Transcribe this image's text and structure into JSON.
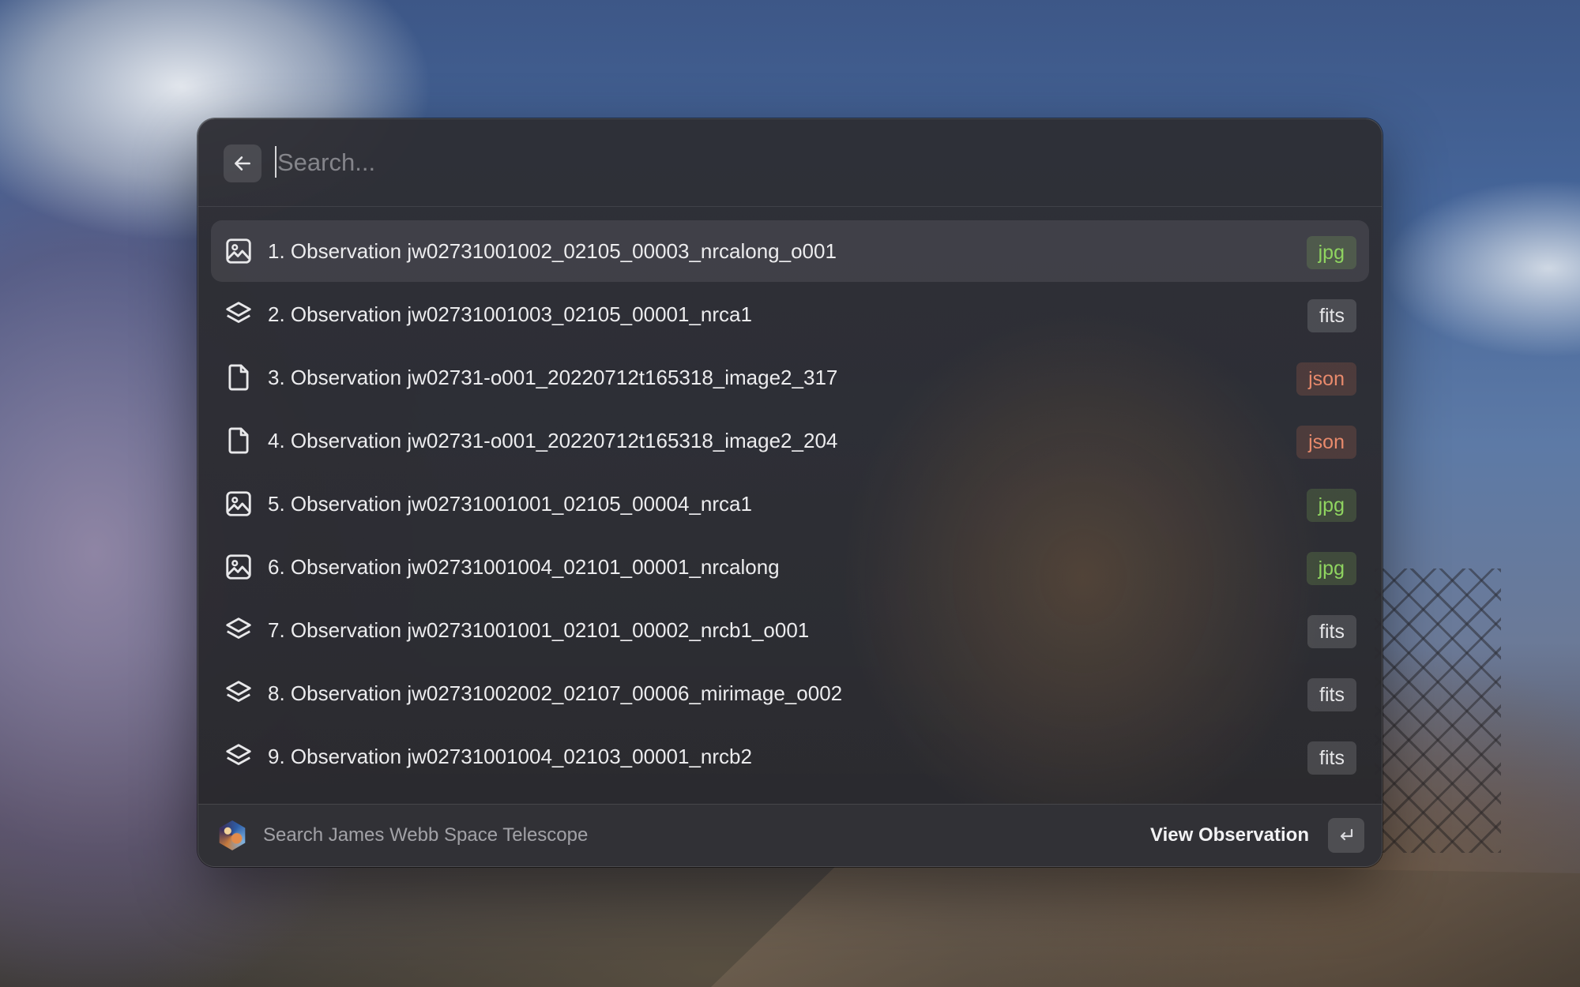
{
  "search": {
    "placeholder": "Search...",
    "value": "",
    "back_icon": "arrow-left-icon"
  },
  "results": [
    {
      "index": "1.",
      "title": "1. Observation jw02731001002_02105_00003_nrcalong_o001",
      "icon": "image-icon",
      "badge": "jpg",
      "selected": true
    },
    {
      "index": "2.",
      "title": "2. Observation jw02731001003_02105_00001_nrca1",
      "icon": "layers-icon",
      "badge": "fits"
    },
    {
      "index": "3.",
      "title": "3. Observation jw02731-o001_20220712t165318_image2_317",
      "icon": "document-icon",
      "badge": "json"
    },
    {
      "index": "4.",
      "title": "4. Observation jw02731-o001_20220712t165318_image2_204",
      "icon": "document-icon",
      "badge": "json"
    },
    {
      "index": "5.",
      "title": "5. Observation jw02731001001_02105_00004_nrca1",
      "icon": "image-icon",
      "badge": "jpg"
    },
    {
      "index": "6.",
      "title": "6. Observation jw02731001004_02101_00001_nrcalong",
      "icon": "image-icon",
      "badge": "jpg"
    },
    {
      "index": "7.",
      "title": "7. Observation jw02731001001_02101_00002_nrcb1_o001",
      "icon": "layers-icon",
      "badge": "fits"
    },
    {
      "index": "8.",
      "title": "8. Observation jw02731002002_02107_00006_mirimage_o002",
      "icon": "layers-icon",
      "badge": "fits"
    },
    {
      "index": "9.",
      "title": "9. Observation jw02731001004_02103_00001_nrcb2",
      "icon": "layers-icon",
      "badge": "fits"
    }
  ],
  "footer": {
    "extension_name": "Search James Webb Space Telescope",
    "primary_action": "View Observation",
    "enter_key_icon": "return-key-icon"
  },
  "colors": {
    "badge_jpg": "#8fd460",
    "badge_fits": "#e6e6e8",
    "badge_json": "#e88a6c"
  }
}
